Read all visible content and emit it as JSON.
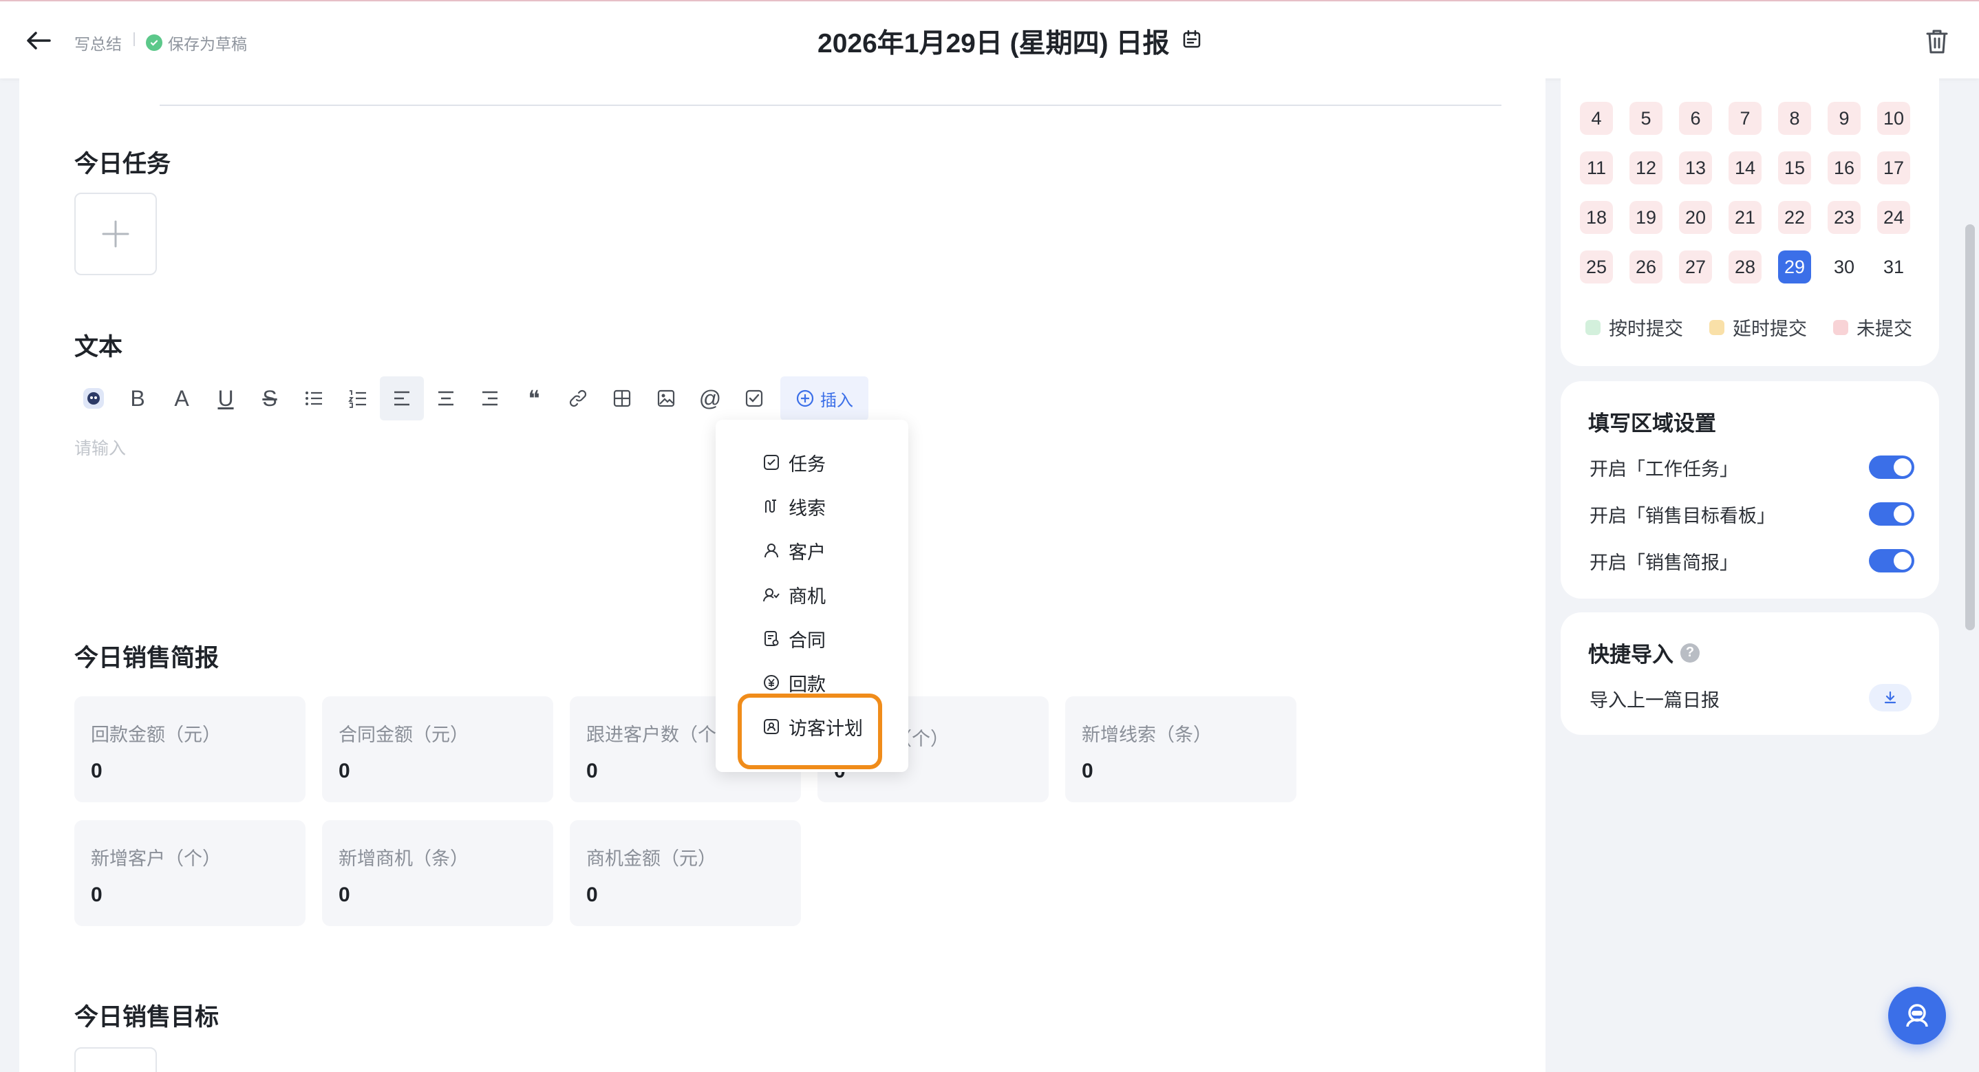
{
  "header": {
    "crumb": "写总结",
    "draft_status": "保存为草稿",
    "title": "2026年1月29日 (星期四) 日报"
  },
  "main": {
    "today_tasks_title": "今日任务",
    "text_title": "文本",
    "text_placeholder": "请输入",
    "toolbar": {
      "insert_label": "插入",
      "bold": "B",
      "font_color": "A",
      "underline": "U",
      "strike": "S",
      "quote": "❝",
      "mention": "@"
    },
    "insert_menu": [
      "任务",
      "线索",
      "客户",
      "商机",
      "合同",
      "回款",
      "访客计划"
    ],
    "sales_brief_title": "今日销售简报",
    "sales_brief": [
      {
        "label": "回款金额（元）",
        "value": "0"
      },
      {
        "label": "合同金额（元）",
        "value": "0"
      },
      {
        "label": "跟进客户数（个",
        "value": "0"
      },
      {
        "label": "（个）",
        "value": "0"
      },
      {
        "label": "新增线索（条）",
        "value": "0"
      },
      {
        "label": "新增客户（个）",
        "value": "0"
      },
      {
        "label": "新增商机（条）",
        "value": "0"
      },
      {
        "label": "商机金额（元）",
        "value": "0"
      }
    ],
    "sales_target_title": "今日销售目标"
  },
  "calendar": {
    "days": [
      "4",
      "5",
      "6",
      "7",
      "8",
      "9",
      "10",
      "11",
      "12",
      "13",
      "14",
      "15",
      "16",
      "17",
      "18",
      "19",
      "20",
      "21",
      "22",
      "23",
      "24",
      "25",
      "26",
      "27",
      "28",
      "29",
      "30",
      "31"
    ],
    "selected_day": "29",
    "legend": [
      {
        "label": "按时提交",
        "color": "#d3f0dc"
      },
      {
        "label": "延时提交",
        "color": "#f9e0a8"
      },
      {
        "label": "未提交",
        "color": "#f8d3d6"
      }
    ]
  },
  "settings": {
    "title": "填写区域设置",
    "items": [
      {
        "label": "开启「工作任务」",
        "on": true
      },
      {
        "label": "开启「销售目标看板」",
        "on": true
      },
      {
        "label": "开启「销售简报」",
        "on": true
      }
    ]
  },
  "quick_import": {
    "title": "快捷导入",
    "item": "导入上一篇日报"
  },
  "colors": {
    "accent": "#3b6fe8",
    "highlight": "#f08c1a"
  }
}
